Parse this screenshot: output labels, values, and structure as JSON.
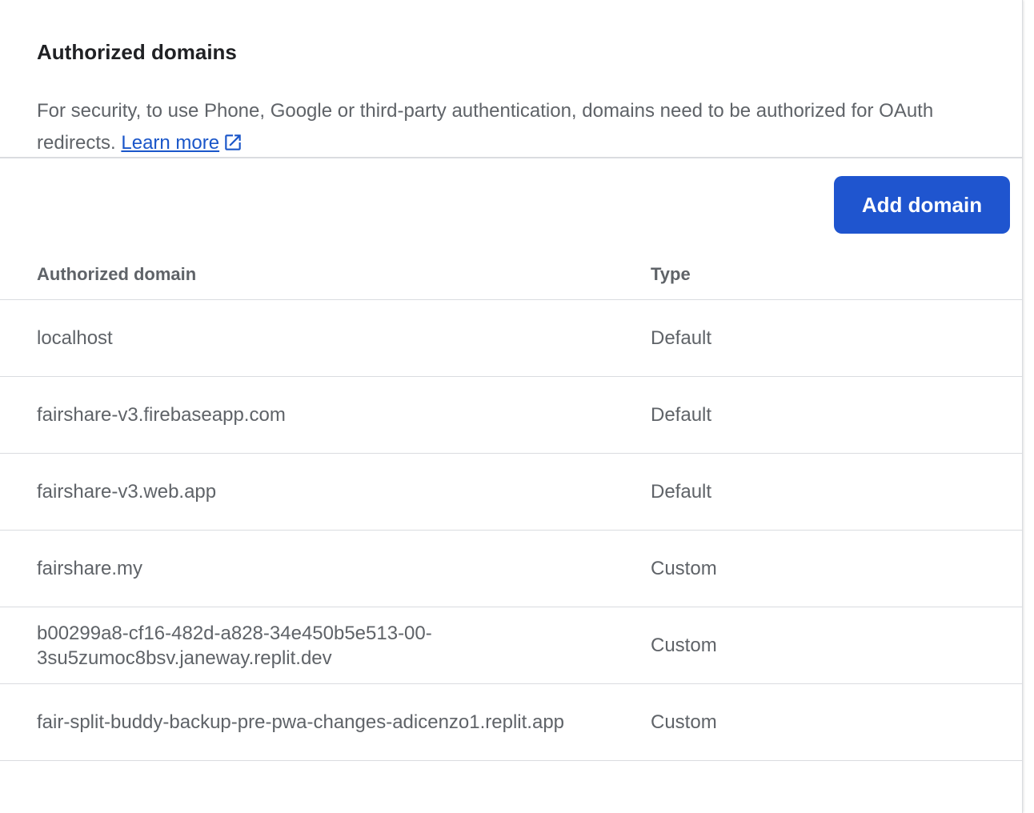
{
  "section": {
    "title": "Authorized domains",
    "description": "For security, to use Phone, Google or third-party authentication, domains need to be authorized for OAuth redirects.",
    "learn_more": "Learn more",
    "learn_more_icon": "open-in-new-icon"
  },
  "toolbar": {
    "add_label": "Add domain"
  },
  "table": {
    "headers": {
      "domain": "Authorized domain",
      "type": "Type"
    },
    "rows": [
      {
        "domain": "localhost",
        "type": "Default"
      },
      {
        "domain": "fairshare-v3.firebaseapp.com",
        "type": "Default"
      },
      {
        "domain": "fairshare-v3.web.app",
        "type": "Default"
      },
      {
        "domain": "fairshare.my",
        "type": "Custom"
      },
      {
        "domain": "b00299a8-cf16-482d-a828-34e450b5e513-00-3su5zumoc8bsv.janeway.replit.dev",
        "type": "Custom"
      },
      {
        "domain": "fair-split-buddy-backup-pre-pwa-changes-adicenzo1.replit.app",
        "type": "Custom"
      }
    ]
  },
  "colors": {
    "primary": "#1f55cf",
    "link": "#1a56c9",
    "text": "#5f6368",
    "divider": "#dadce0"
  }
}
